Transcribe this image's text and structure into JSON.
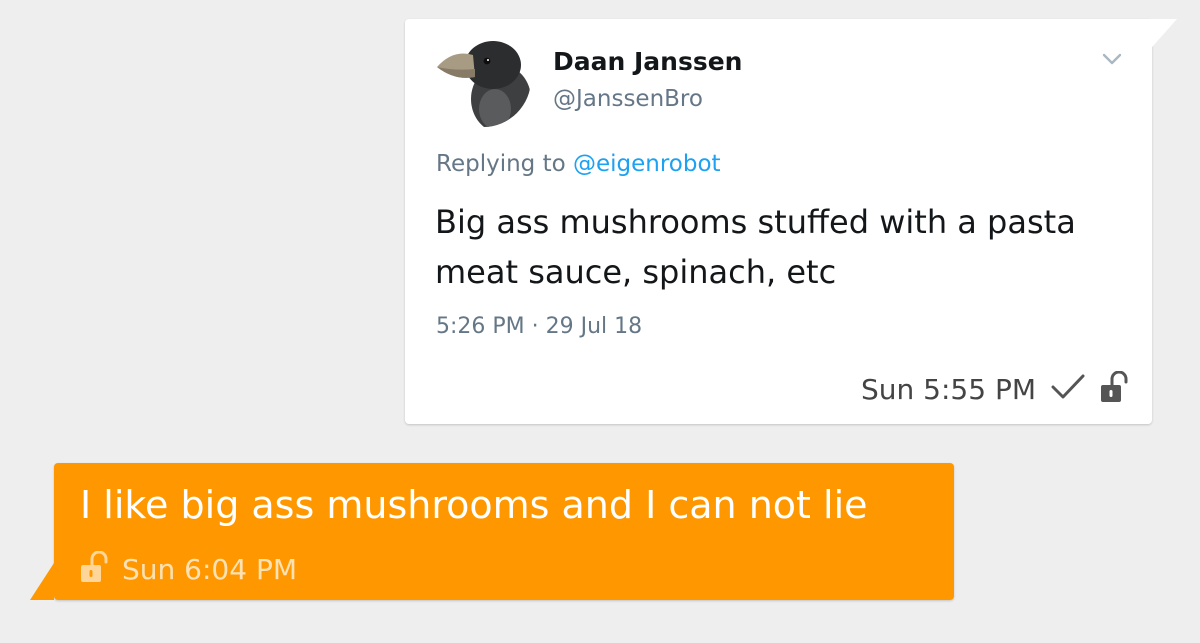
{
  "tweet": {
    "author_name": "Daan Janssen",
    "author_handle": "@JanssenBro",
    "replying_prefix": "Replying to",
    "replying_to": "@eigenrobot",
    "body": "Big ass mushrooms stuffed with a pasta meat sauce, spinach, etc",
    "timestamp": "5:26 PM · 29 Jul 18",
    "avatar_icon": "bird-avatar-icon",
    "menu_icon": "chevron-down-icon"
  },
  "outgoing_message": {
    "time": "Sun 5:55 PM",
    "status_icon": "checkmark-icon",
    "lock_icon": "unlocked-padlock-icon"
  },
  "incoming_message": {
    "text": "I like big ass mushrooms and I can not lie",
    "time": "Sun 6:04 PM",
    "lock_icon": "unlocked-padlock-icon"
  },
  "colors": {
    "background": "#eeeeee",
    "outgoing_bubble": "#ffffff",
    "incoming_bubble": "#ff9800",
    "mention": "#1da1f2",
    "secondary_text": "#657786"
  }
}
